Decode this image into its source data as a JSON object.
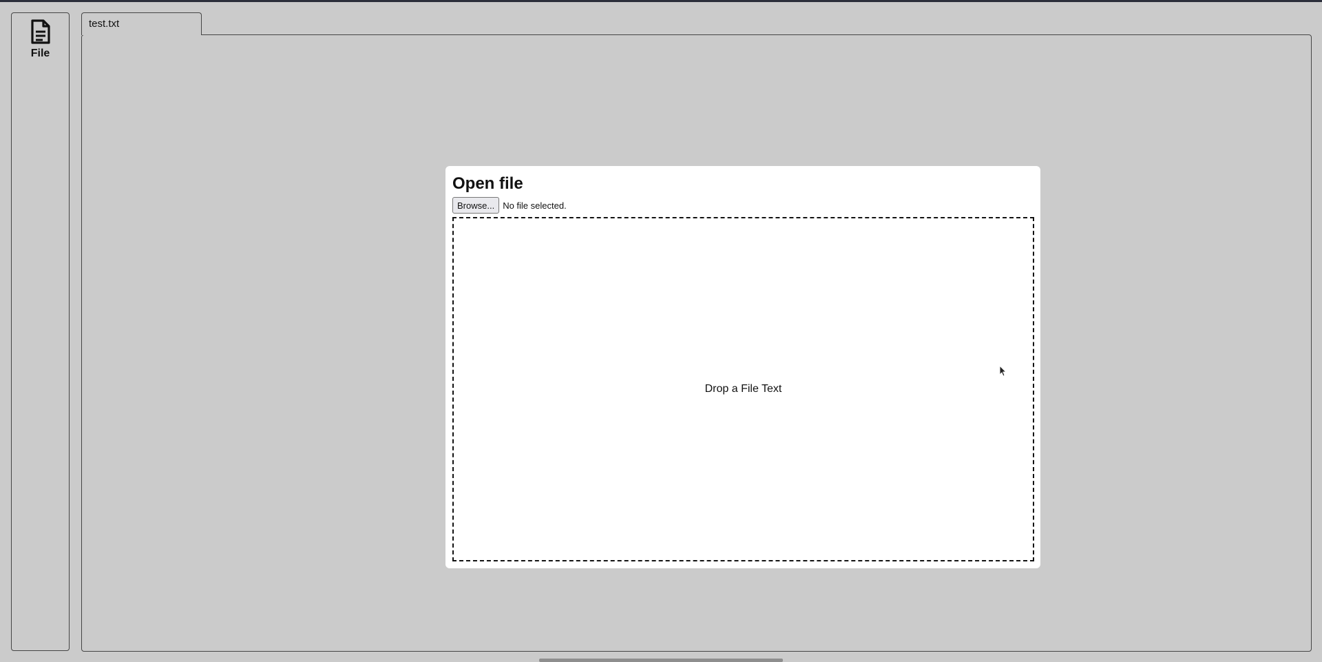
{
  "sidebar": {
    "file_button": {
      "icon": "document-icon",
      "label": "File"
    }
  },
  "tabs": [
    {
      "label": "test.txt"
    }
  ],
  "dialog": {
    "title": "Open file",
    "browse_label": "Browse...",
    "file_status": "No file selected.",
    "drop_zone_text": "Drop a File Text"
  },
  "colors": {
    "background": "#cbcbcb",
    "dialog_background": "#ffffff",
    "border": "#444444",
    "top_strip": "#2b2e3a"
  }
}
